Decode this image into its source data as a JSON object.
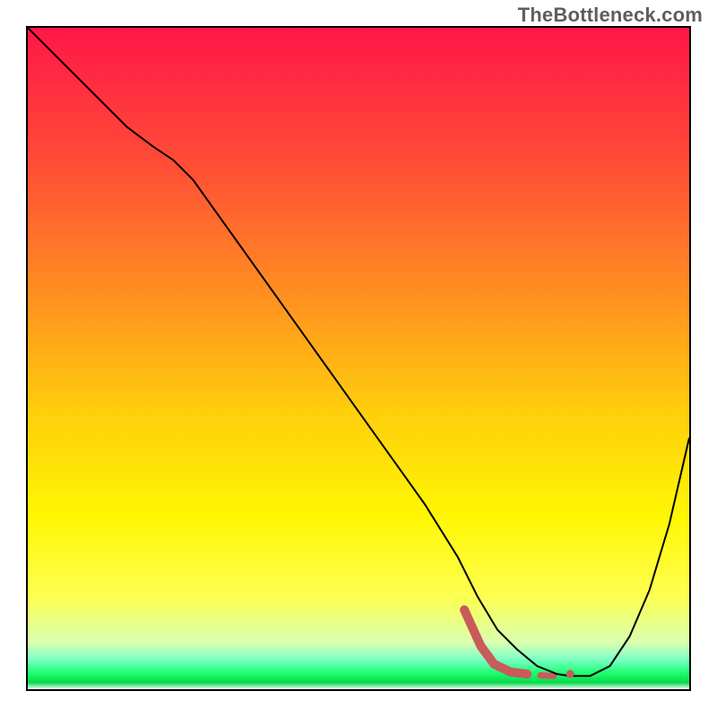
{
  "watermark": "TheBottleneck.com",
  "chart_data": {
    "type": "line",
    "title": "",
    "xlabel": "",
    "ylabel": "",
    "xlim": [
      0,
      100
    ],
    "ylim": [
      0,
      100
    ],
    "grid": false,
    "legend": false,
    "background_gradient": {
      "stops": [
        {
          "offset": 0.0,
          "color": "#ff1648"
        },
        {
          "offset": 0.2,
          "color": "#ff4b36"
        },
        {
          "offset": 0.4,
          "color": "#ff8e21"
        },
        {
          "offset": 0.58,
          "color": "#ffce0c"
        },
        {
          "offset": 0.74,
          "color": "#fff703"
        },
        {
          "offset": 0.86,
          "color": "#fdff51"
        },
        {
          "offset": 0.93,
          "color": "#d9ffb0"
        },
        {
          "offset": 0.955,
          "color": "#7dffc5"
        },
        {
          "offset": 0.975,
          "color": "#1fff74"
        },
        {
          "offset": 0.99,
          "color": "#06d94b"
        },
        {
          "offset": 1.0,
          "color": "#ffffff"
        }
      ]
    },
    "main_curve": {
      "stroke": "#000000",
      "stroke_width": 2,
      "x": [
        0,
        5,
        10,
        15,
        19,
        22,
        25,
        30,
        35,
        40,
        45,
        50,
        55,
        60,
        65,
        68,
        71,
        74,
        77,
        80,
        82,
        85,
        88,
        91,
        94,
        97,
        100
      ],
      "y": [
        100,
        95,
        90,
        85,
        82,
        80,
        77,
        70,
        63,
        56,
        49,
        42,
        35,
        28,
        20,
        14,
        9,
        6,
        3.5,
        2.3,
        2.0,
        2.0,
        3.5,
        8.0,
        15,
        25,
        38
      ]
    },
    "highlight_segments": [
      {
        "stroke": "#c95b5b",
        "stroke_width": 10,
        "cap": "round",
        "points": [
          {
            "x": 66.0,
            "y": 12.0
          },
          {
            "x": 68.5,
            "y": 6.5
          },
          {
            "x": 70.5,
            "y": 3.8
          },
          {
            "x": 73.0,
            "y": 2.6
          },
          {
            "x": 75.5,
            "y": 2.3
          }
        ]
      },
      {
        "stroke": "#c95b5b",
        "stroke_width": 7,
        "cap": "round",
        "points": [
          {
            "x": 77.5,
            "y": 2.1
          },
          {
            "x": 79.5,
            "y": 2.0
          }
        ]
      }
    ],
    "highlight_dots": [
      {
        "x": 82.0,
        "y": 2.3,
        "r": 4.5,
        "fill": "#c95b5b"
      }
    ]
  }
}
